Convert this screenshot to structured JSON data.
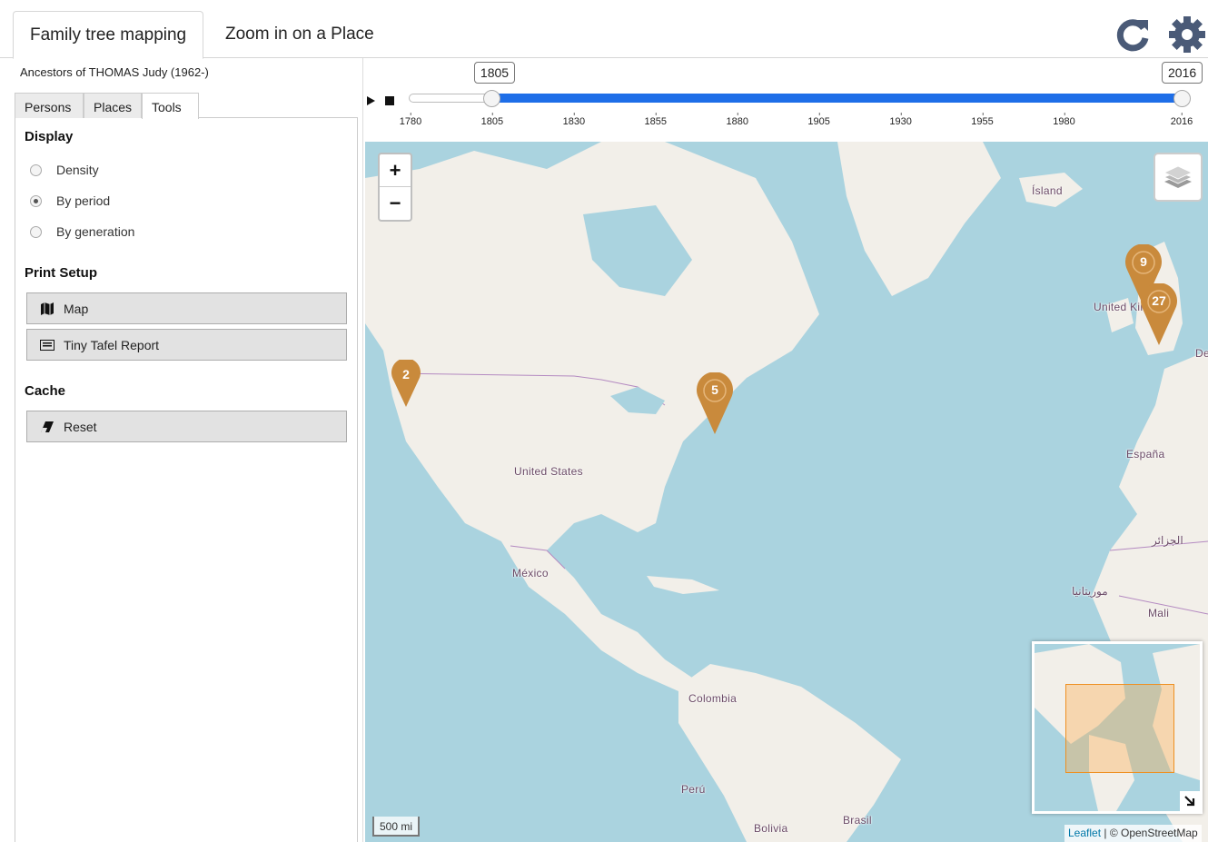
{
  "top_tabs": [
    {
      "label": "Family tree mapping",
      "active": true
    },
    {
      "label": "Zoom in on a Place",
      "active": false
    }
  ],
  "toolbar": {
    "refresh_icon": "refresh-icon",
    "settings_icon": "gear-icon"
  },
  "left_panel": {
    "subtitle": "Ancestors of THOMAS Judy (1962-)",
    "tabs": [
      {
        "label": "Persons",
        "active": false
      },
      {
        "label": "Places",
        "active": false
      },
      {
        "label": "Tools",
        "active": true
      }
    ],
    "display": {
      "heading": "Display",
      "options": [
        {
          "label": "Density",
          "selected": false
        },
        {
          "label": "By period",
          "selected": true
        },
        {
          "label": "By generation",
          "selected": false
        }
      ]
    },
    "print_setup": {
      "heading": "Print Setup",
      "buttons": [
        {
          "label": "Map",
          "icon": "map-icon"
        },
        {
          "label": "Tiny Tafel Report",
          "icon": "list-icon"
        }
      ]
    },
    "cache": {
      "heading": "Cache",
      "buttons": [
        {
          "label": "Reset",
          "icon": "eraser-icon"
        }
      ]
    }
  },
  "timeline": {
    "min": 1780,
    "max": 2016,
    "from": 1805,
    "to": 2016,
    "from_label": "1805",
    "to_label": "2016",
    "ticks": [
      "1780",
      "1805",
      "1830",
      "1855",
      "1880",
      "1905",
      "1930",
      "1955",
      "1980",
      "2016"
    ],
    "fill_color": "#1e6ee8"
  },
  "map": {
    "zoom_in": "+",
    "zoom_out": "−",
    "labels": [
      "Ísland",
      "United Kingdom",
      "De",
      "España",
      "United States",
      "México",
      "الجزائر",
      "موريتانيا",
      "Mali",
      "Colombia",
      "Perú",
      "Brasil",
      "Bolivia"
    ],
    "markers": [
      "2",
      "5",
      "9",
      "27"
    ],
    "marker_color": "#c98a3c",
    "scale": "500 mi",
    "attribution_link": "Leaflet",
    "attribution_rest": " | © OpenStreetMap"
  }
}
